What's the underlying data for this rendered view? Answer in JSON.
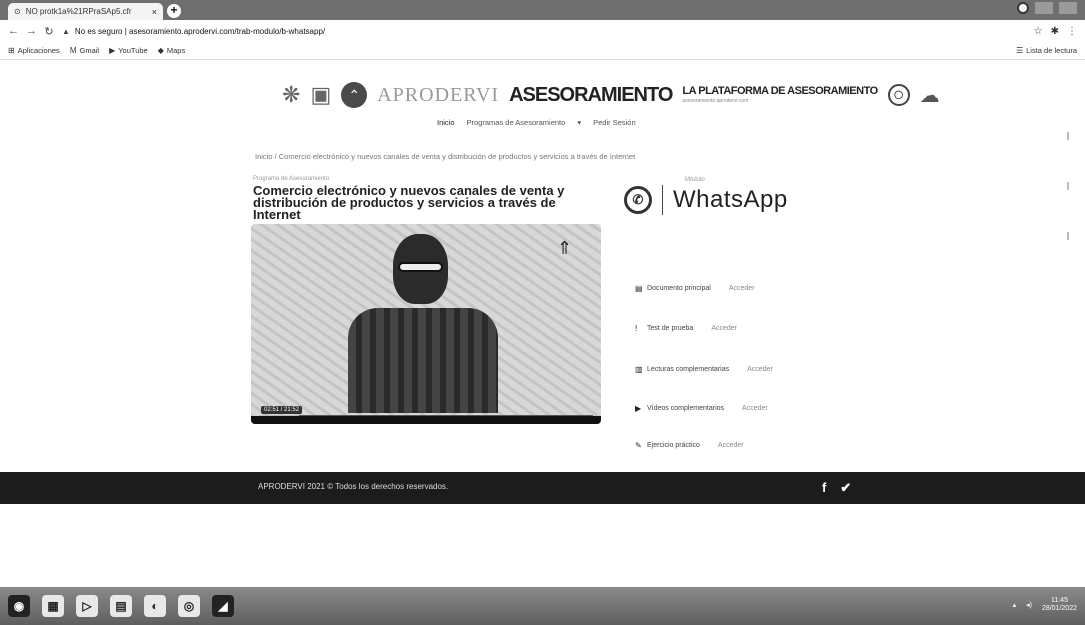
{
  "browser": {
    "tab_title": "NO protk1a%21RPraSAp5.cfr",
    "tab_close": "×",
    "new_tab": "+",
    "address": "No es seguro | asesoramiento.aprodervi.com/trab-modulo/b-whatsapp/",
    "address_warning": "▲",
    "bookmarks": [
      {
        "icon": "grid-icon",
        "label": "Aplicaciones"
      },
      {
        "icon": "mail-icon",
        "label": "Gmail"
      },
      {
        "icon": "youtube-icon",
        "label": "YouTube"
      },
      {
        "icon": "maps-icon",
        "label": "Maps"
      }
    ],
    "reading_list": "Lista de lectura"
  },
  "header": {
    "brand_light": "APRODERVI",
    "brand_bold": "ASESORAMIENTO",
    "platform_title": "LA PLATAFORMA DE ASESORAMIENTO",
    "platform_sub": "asesoramiento.aprodervi.com"
  },
  "nav": {
    "items": [
      "Inicio",
      "Programas de Asesoramiento",
      "Pedir Sesión"
    ]
  },
  "breadcrumb": "Inicio  /  Comercio electrónico y nuevos canales de venta y distribución de productos y servicios a través de Internet",
  "course": {
    "label": "Programa de Asesoramiento",
    "title": "Comercio electrónico y nuevos canales de venta y distribución de productos y servicios a través de Internet"
  },
  "video": {
    "time": "02:51 / 21:52",
    "progress": 0.12
  },
  "module": {
    "label": "Módulo",
    "title": "WhatsApp"
  },
  "resources": [
    {
      "label": "Documento principal",
      "action": "Acceder"
    },
    {
      "label": "Test de prueba",
      "action": "Acceder"
    },
    {
      "label": "Lecturas complementarias",
      "action": "Acceder"
    },
    {
      "label": "Vídeos complementarios",
      "action": "Acceder"
    },
    {
      "label": "Ejercicio práctico",
      "action": "Acceder"
    }
  ],
  "footer": {
    "text": "APRODERVI 2021 © Todos los derechos reservados."
  },
  "taskbar": {
    "time": "11:45",
    "date": "28/01/2022"
  }
}
